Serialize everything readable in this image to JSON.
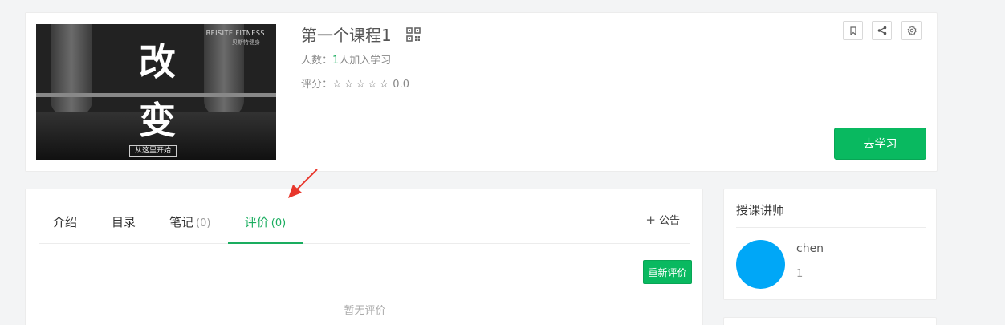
{
  "course": {
    "title": "第一个课程1",
    "people_label": "人数：",
    "people_count": "1",
    "people_suffix": "人加入学习",
    "rating_label": "评分：",
    "stars": "☆☆☆☆☆",
    "rating_value": "0.0",
    "study_button": "去学习",
    "cover": {
      "main_char_1": "改",
      "main_char_2": "变",
      "brand": "BEISITE FITNESS",
      "brand_cn": "贝斯特健身",
      "tag": "从这里开始"
    },
    "icons": [
      "qr-code-icon",
      "bookmark-icon",
      "share-icon",
      "settings-icon"
    ]
  },
  "tabs": [
    {
      "label": "介绍",
      "count": ""
    },
    {
      "label": "目录",
      "count": ""
    },
    {
      "label": "笔记",
      "count": "(0)"
    },
    {
      "label": "评价",
      "count": "(0)",
      "active": true
    }
  ],
  "announce": {
    "plus": "+",
    "label": "公告"
  },
  "review": {
    "rereview_button": "重新评价",
    "empty_text": "暂无评价"
  },
  "teacher": {
    "heading": "授课讲师",
    "name": "chen",
    "sub": "1"
  },
  "colors": {
    "accent": "#09b960",
    "avatar": "#00a7f7",
    "annotation_arrow": "#e8372c"
  }
}
